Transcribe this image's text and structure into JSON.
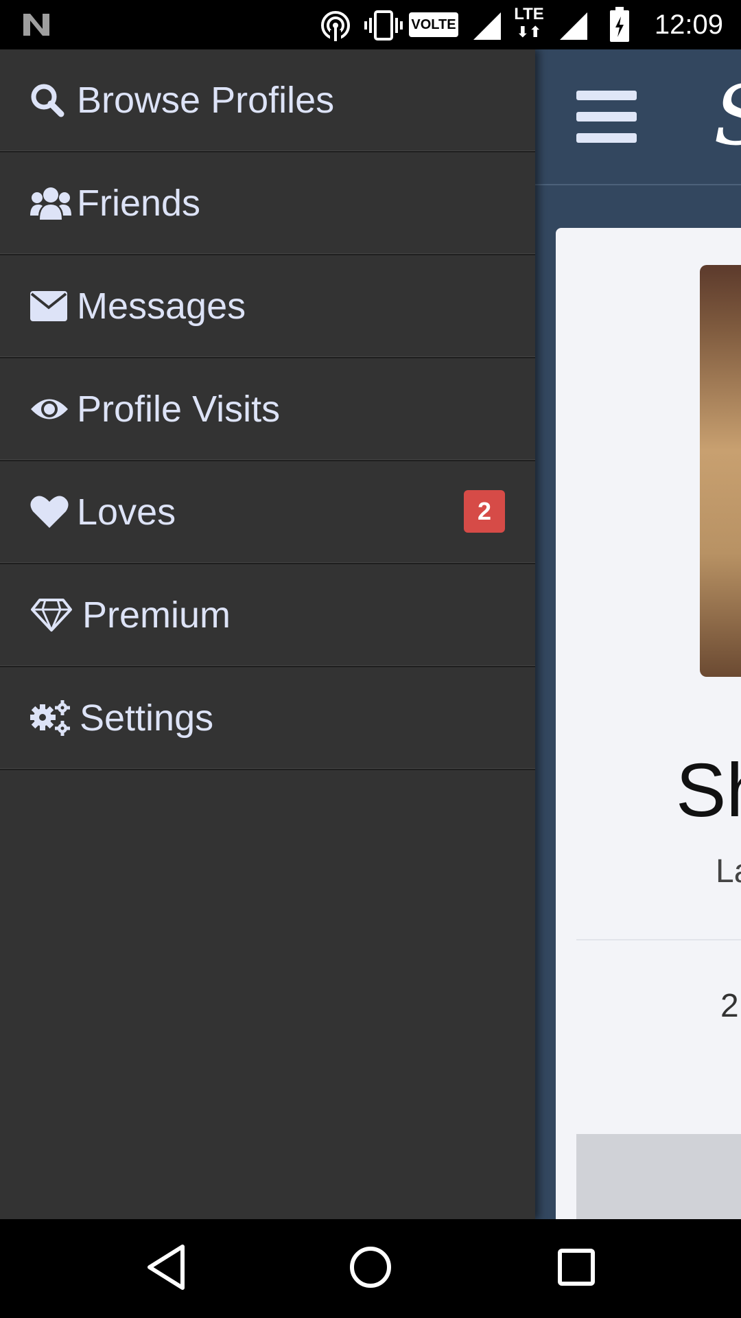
{
  "status_bar": {
    "time": "12:09",
    "network_label": "LTE",
    "volte_label": "VOLTE",
    "icons": [
      "notification-n-icon",
      "hotspot-icon",
      "vibrate-icon",
      "volte-icon",
      "signal-icon",
      "lte-icon",
      "signal-icon",
      "battery-charging-icon"
    ]
  },
  "drawer": {
    "items": [
      {
        "label": "Browse Profiles",
        "icon": "search-icon"
      },
      {
        "label": "Friends",
        "icon": "users-icon"
      },
      {
        "label": "Messages",
        "icon": "envelope-icon"
      },
      {
        "label": "Profile Visits",
        "icon": "eye-icon"
      },
      {
        "label": "Loves",
        "icon": "heart-icon",
        "badge": "2"
      },
      {
        "label": "Premium",
        "icon": "diamond-icon"
      },
      {
        "label": "Settings",
        "icon": "gears-icon"
      }
    ]
  },
  "background": {
    "brand_fragment": "S",
    "name_fragment": "Sh",
    "subtitle_fragment": "La",
    "number_fragment": "2"
  },
  "colors": {
    "drawer_bg": "#333333",
    "drawer_text": "#dde3f7",
    "app_bg": "#33475f",
    "badge": "#d64b47"
  },
  "nav_bar": {
    "buttons": [
      "back-icon",
      "home-icon",
      "recents-icon"
    ]
  }
}
